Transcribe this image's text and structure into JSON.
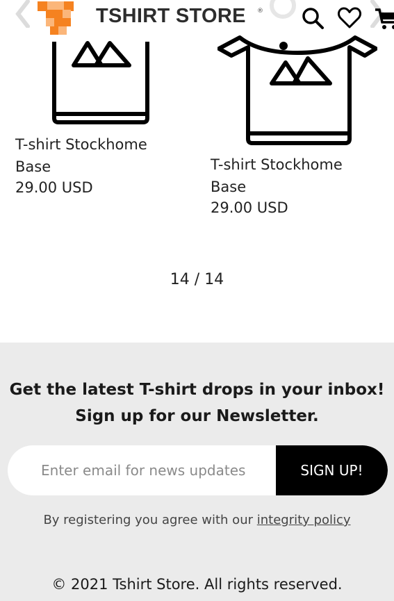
{
  "header": {
    "brand": "TSHIRT STORE",
    "brand_mark": "®",
    "icons": [
      "search-icon",
      "heart-icon",
      "cart-icon"
    ],
    "logo_colors": [
      "#f58220",
      "#fbb67a"
    ]
  },
  "products": [
    {
      "title": "T-shirt Stockhome Base",
      "price": "29.00 USD",
      "image_icon": "tshirt-image-placeholder-icon"
    },
    {
      "title": "T-shirt Stockhome Base",
      "price": "29.00 USD",
      "image_icon": "tshirt-image-placeholder-icon"
    }
  ],
  "pagination": {
    "text": "14 / 14"
  },
  "newsletter": {
    "heading": "Get the latest T-shirt drops in your inbox! Sign up for our Newsletter.",
    "input_placeholder": "Enter email for news updates",
    "button_label": "SIGN UP!",
    "note_prefix": "By registering you agree with our",
    "policy_link": "integrity policy",
    "background": "#ebebeb"
  },
  "footer": {
    "copyright": "© 2021 Tshirt Store. All rights reserved."
  }
}
